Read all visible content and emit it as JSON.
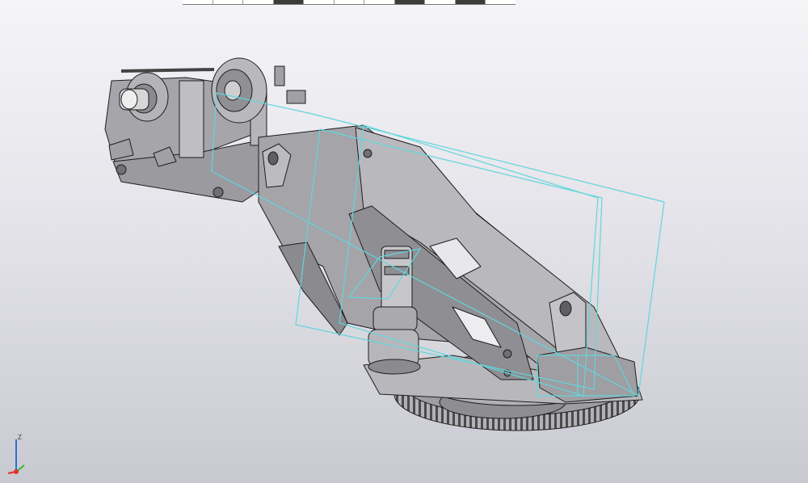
{
  "toolbar_strip": {
    "segments": [
      "white",
      "white",
      "white",
      "dark",
      "white",
      "white",
      "white",
      "dark",
      "white",
      "dark",
      "white"
    ],
    "colors": {
      "white": "#ffffff",
      "dark": "#3c3c3c"
    }
  },
  "viewport": {
    "model": "crane-boom-assembly",
    "colors": {
      "body": "#a9a9ad",
      "body_dark": "#77777c",
      "body_light": "#c9c9cc",
      "edge": "#1e1e1e",
      "selection_outline": "#62d6dc"
    }
  },
  "axis_triad": {
    "labels": {
      "z": "Z"
    },
    "colors": {
      "x": "#e0302a",
      "y": "#2bbb3c",
      "z": "#2a6fe0"
    }
  }
}
